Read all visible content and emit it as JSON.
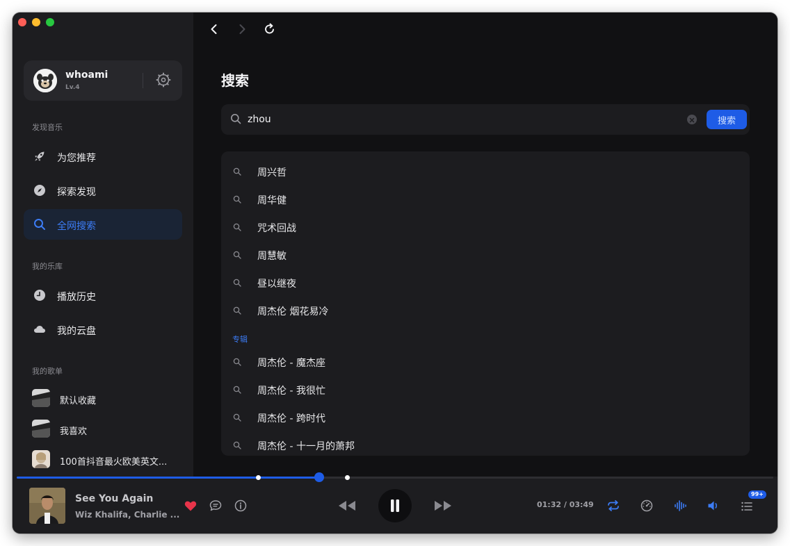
{
  "window": {
    "controls": [
      "close",
      "minimize",
      "zoom"
    ]
  },
  "user": {
    "name": "whoami",
    "level": "Lv.4"
  },
  "sidebar": {
    "discover_label": "发现音乐",
    "discover_items": [
      {
        "label": "为您推荐",
        "icon": "rocket-icon"
      },
      {
        "label": "探索发现",
        "icon": "compass-icon"
      },
      {
        "label": "全网搜索",
        "icon": "search-icon",
        "active": true
      }
    ],
    "library_label": "我的乐库",
    "library_items": [
      {
        "label": "播放历史",
        "icon": "clock-icon"
      },
      {
        "label": "我的云盘",
        "icon": "cloud-icon"
      }
    ],
    "playlists_label": "我的歌单",
    "playlists": [
      {
        "label": "默认收藏"
      },
      {
        "label": "我喜欢"
      },
      {
        "label": "100首抖音最火欧美英文..."
      }
    ]
  },
  "main": {
    "title": "搜索",
    "search": {
      "value": "zhou",
      "button_label": "搜索"
    },
    "suggestions": [
      "周兴哲",
      "周华健",
      "咒术回战",
      "周慧敏",
      "昼以继夜",
      "周杰伦 烟花易冷"
    ],
    "album_label": "专辑",
    "album_suggestions": [
      "周杰伦 - 魔杰座",
      "周杰伦 - 我很忙",
      "周杰伦 - 跨时代",
      "周杰伦 - 十一月的萧邦"
    ]
  },
  "player": {
    "title": "See You Again",
    "artist": "Wiz Khalifa, Charlie ...",
    "time": "01:32 / 03:49",
    "progress": 0.4,
    "queue_badge": "99+",
    "liked": true,
    "accent": "#1e5ce6",
    "heart_color": "#e8344a"
  }
}
